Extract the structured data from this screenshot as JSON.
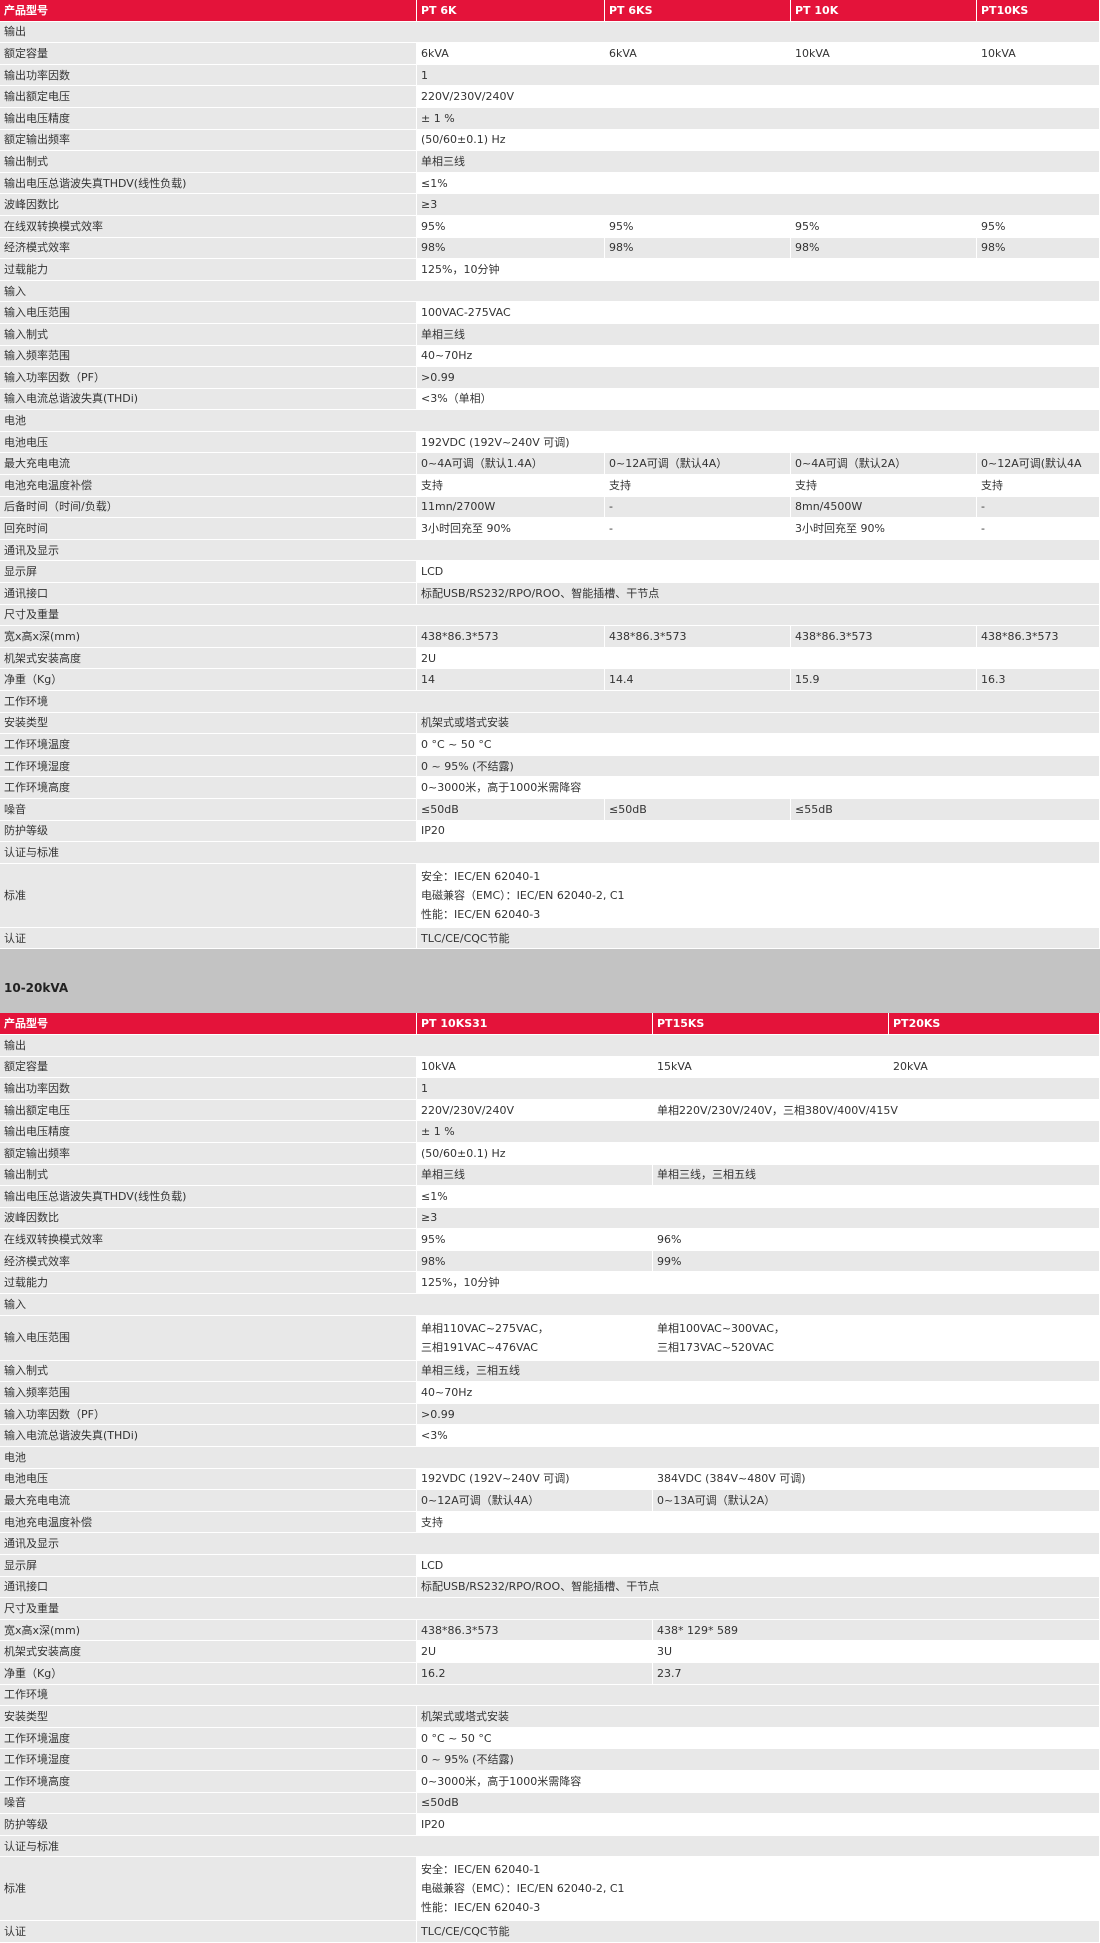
{
  "colors": {
    "header_red": "#e4133a",
    "band_gray": "#c3c3c3",
    "row_gray": "#e8e8e8"
  },
  "tables": [
    {
      "widths": [
        417,
        188,
        186,
        186,
        123
      ],
      "header": [
        "产品型号",
        "PT 6K",
        "PT 6KS",
        "PT 10K",
        "PT10KS"
      ],
      "rows": [
        {
          "cells": [
            [
              "输出"
            ]
          ]
        },
        {
          "cells": [
            [
              "额定容量"
            ],
            [
              "6kVA"
            ],
            [
              "6kVA"
            ],
            [
              "10kVA"
            ],
            [
              "10kVA"
            ]
          ]
        },
        {
          "cells": [
            [
              "输出功率因数"
            ],
            [
              "1"
            ]
          ]
        },
        {
          "cells": [
            [
              "输出额定电压"
            ],
            [
              "220V/230V/240V"
            ]
          ]
        },
        {
          "cells": [
            [
              "输出电压精度"
            ],
            [
              "± 1 %"
            ]
          ]
        },
        {
          "cells": [
            [
              "额定输出频率"
            ],
            [
              "(50/60±0.1) Hz"
            ]
          ]
        },
        {
          "cells": [
            [
              "输出制式"
            ],
            [
              "单相三线"
            ]
          ]
        },
        {
          "cells": [
            [
              "输出电压总谐波失真THDV(线性负载)"
            ],
            [
              "≤1%"
            ]
          ]
        },
        {
          "cells": [
            [
              "波峰因数比"
            ],
            [
              "≥3"
            ]
          ]
        },
        {
          "cells": [
            [
              "在线双转换模式效率"
            ],
            [
              "95%"
            ],
            [
              "95%"
            ],
            [
              "95%"
            ],
            [
              "95%"
            ]
          ]
        },
        {
          "cells": [
            [
              "经济模式效率"
            ],
            [
              "98%"
            ],
            [
              "98%"
            ],
            [
              "98%"
            ],
            [
              "98%"
            ]
          ]
        },
        {
          "cells": [
            [
              "过载能力"
            ],
            [
              "125%，10分钟"
            ]
          ]
        },
        {
          "cells": [
            [
              "输入"
            ]
          ]
        },
        {
          "cells": [
            [
              "输入电压范围"
            ],
            [
              "100VAC-275VAC"
            ]
          ]
        },
        {
          "cells": [
            [
              "输入制式"
            ],
            [
              "单相三线"
            ]
          ]
        },
        {
          "cells": [
            [
              "输入频率范围"
            ],
            [
              "40~70Hz"
            ]
          ]
        },
        {
          "cells": [
            [
              "输入功率因数（PF）"
            ],
            [
              ">0.99"
            ]
          ]
        },
        {
          "cells": [
            [
              "输入电流总谐波失真(THDi)"
            ],
            [
              "<3%（单相）"
            ]
          ]
        },
        {
          "cells": [
            [
              "电池"
            ]
          ]
        },
        {
          "cells": [
            [
              "电池电压"
            ],
            [
              "192VDC (192V~240V 可调)"
            ]
          ]
        },
        {
          "cells": [
            [
              "最大充电电流"
            ],
            [
              "0~4A可调（默认1.4A）"
            ],
            [
              "0~12A可调（默认4A）"
            ],
            [
              "0~4A可调（默认2A）"
            ],
            [
              "0~12A可调(默认4A"
            ]
          ]
        },
        {
          "cells": [
            [
              "电池充电温度补偿"
            ],
            [
              "支持"
            ],
            [
              "支持"
            ],
            [
              "支持"
            ],
            [
              "支持"
            ]
          ]
        },
        {
          "cells": [
            [
              "后备时间（时间/负载）"
            ],
            [
              "11mn/2700W"
            ],
            [
              "-"
            ],
            [
              "8mn/4500W"
            ],
            [
              "-"
            ]
          ]
        },
        {
          "cells": [
            [
              "回充时间"
            ],
            [
              "3小时回充至 90%"
            ],
            [
              "-"
            ],
            [
              "3小时回充至 90%"
            ],
            [
              "-"
            ]
          ]
        },
        {
          "cells": [
            [
              "通讯及显示"
            ]
          ]
        },
        {
          "cells": [
            [
              "显示屏"
            ],
            [
              "LCD"
            ]
          ]
        },
        {
          "cells": [
            [
              "通讯接口"
            ],
            [
              "标配USB/RS232/RPO/ROO、智能插槽、干节点"
            ]
          ]
        },
        {
          "cells": [
            [
              "尺寸及重量"
            ]
          ]
        },
        {
          "cells": [
            [
              "宽x高x深(mm)"
            ],
            [
              "438*86.3*573"
            ],
            [
              "438*86.3*573"
            ],
            [
              "438*86.3*573"
            ],
            [
              "438*86.3*573"
            ]
          ]
        },
        {
          "cells": [
            [
              "机架式安装高度"
            ],
            [
              "2U"
            ]
          ]
        },
        {
          "cells": [
            [
              "净重（Kg）"
            ],
            [
              "14"
            ],
            [
              "14.4"
            ],
            [
              "15.9"
            ],
            [
              "16.3"
            ]
          ]
        },
        {
          "cells": [
            [
              "工作环境"
            ]
          ]
        },
        {
          "cells": [
            [
              "安装类型"
            ],
            [
              "机架式或塔式安装"
            ]
          ]
        },
        {
          "cells": [
            [
              "工作环境温度"
            ],
            [
              "0 °C ~ 50 °C"
            ]
          ]
        },
        {
          "cells": [
            [
              "工作环境湿度"
            ],
            [
              "0 ~ 95% (不结露)"
            ]
          ]
        },
        {
          "cells": [
            [
              "工作环境高度"
            ],
            [
              "0~3000米，高于1000米需降容"
            ]
          ]
        },
        {
          "cells": [
            [
              "噪音"
            ],
            [
              "≤50dB"
            ],
            [
              "≤50dB"
            ],
            [
              "≤55dB"
            ]
          ]
        },
        {
          "cells": [
            [
              "防护等级"
            ],
            [
              "IP20"
            ]
          ]
        },
        {
          "cells": [
            [
              "认证与标准"
            ]
          ]
        },
        {
          "cells": [
            [
              "标准"
            ],
            [
              "安全：IEC/EN 62040-1",
              "电磁兼容（EMC）：IEC/EN 62040-2, C1",
              "性能：IEC/EN 62040-3"
            ]
          ]
        },
        {
          "cells": [
            [
              "认证"
            ],
            [
              "TLC/CE/CQC节能"
            ]
          ]
        }
      ]
    },
    {
      "title": "10-20kVA",
      "widths": [
        417,
        236,
        236,
        211
      ],
      "header": [
        "产品型号",
        "PT 10KS31",
        "PT15KS",
        "PT20KS"
      ],
      "rows": [
        {
          "cells": [
            [
              "输出"
            ]
          ]
        },
        {
          "cells": [
            [
              "额定容量"
            ],
            [
              "10kVA"
            ],
            [
              "15kVA"
            ],
            [
              "20kVA"
            ]
          ]
        },
        {
          "cells": [
            [
              "输出功率因数"
            ],
            [
              "1"
            ]
          ]
        },
        {
          "cells": [
            [
              "输出额定电压"
            ],
            [
              "220V/230V/240V"
            ],
            [
              "单相220V/230V/240V，三相380V/400V/415V"
            ]
          ]
        },
        {
          "cells": [
            [
              "输出电压精度"
            ],
            [
              "± 1 %"
            ]
          ]
        },
        {
          "cells": [
            [
              "额定输出频率"
            ],
            [
              "(50/60±0.1) Hz"
            ]
          ]
        },
        {
          "cells": [
            [
              "输出制式"
            ],
            [
              "单相三线"
            ],
            [
              "单相三线，三相五线"
            ]
          ]
        },
        {
          "cells": [
            [
              "输出电压总谐波失真THDV(线性负载)"
            ],
            [
              "≤1%"
            ]
          ]
        },
        {
          "cells": [
            [
              "波峰因数比"
            ],
            [
              "≥3"
            ]
          ]
        },
        {
          "cells": [
            [
              "在线双转换模式效率"
            ],
            [
              "95%"
            ],
            [
              "96%"
            ]
          ]
        },
        {
          "cells": [
            [
              "经济模式效率"
            ],
            [
              "98%"
            ],
            [
              "99%"
            ]
          ]
        },
        {
          "cells": [
            [
              "过载能力"
            ],
            [
              "125%，10分钟"
            ]
          ]
        },
        {
          "cells": [
            [
              "输入"
            ]
          ]
        },
        {
          "cells": [
            [
              "输入电压范围"
            ],
            [
              "单相110VAC~275VAC，",
              "三相191VAC~476VAC"
            ],
            [
              "单相100VAC~300VAC，",
              "三相173VAC~520VAC"
            ]
          ]
        },
        {
          "cells": [
            [
              "输入制式"
            ],
            [
              "单相三线，三相五线"
            ]
          ]
        },
        {
          "cells": [
            [
              "输入频率范围"
            ],
            [
              "40~70Hz"
            ]
          ]
        },
        {
          "cells": [
            [
              "输入功率因数（PF）"
            ],
            [
              ">0.99"
            ]
          ]
        },
        {
          "cells": [
            [
              "输入电流总谐波失真(THDi)"
            ],
            [
              "<3%"
            ]
          ]
        },
        {
          "cells": [
            [
              "电池"
            ]
          ]
        },
        {
          "cells": [
            [
              "电池电压"
            ],
            [
              "192VDC (192V~240V 可调)"
            ],
            [
              "384VDC (384V~480V 可调)"
            ]
          ]
        },
        {
          "cells": [
            [
              "最大充电电流"
            ],
            [
              "0~12A可调（默认4A）"
            ],
            [
              "0~13A可调（默认2A）"
            ]
          ]
        },
        {
          "cells": [
            [
              "电池充电温度补偿"
            ],
            [
              "支持"
            ]
          ]
        },
        {
          "cells": [
            [
              "通讯及显示"
            ]
          ]
        },
        {
          "cells": [
            [
              "显示屏"
            ],
            [
              "LCD"
            ]
          ]
        },
        {
          "cells": [
            [
              "通讯接口"
            ],
            [
              "标配USB/RS232/RPO/ROO、智能插槽、干节点"
            ]
          ]
        },
        {
          "cells": [
            [
              "尺寸及重量"
            ]
          ]
        },
        {
          "cells": [
            [
              "宽x高x深(mm)"
            ],
            [
              "438*86.3*573"
            ],
            [
              "438* 129* 589"
            ]
          ]
        },
        {
          "cells": [
            [
              "机架式安装高度"
            ],
            [
              "2U"
            ],
            [
              "3U"
            ]
          ]
        },
        {
          "cells": [
            [
              "净重（Kg）"
            ],
            [
              "16.2"
            ],
            [
              "23.7"
            ]
          ]
        },
        {
          "cells": [
            [
              "工作环境"
            ]
          ]
        },
        {
          "cells": [
            [
              "安装类型"
            ],
            [
              "机架式或塔式安装"
            ]
          ]
        },
        {
          "cells": [
            [
              "工作环境温度"
            ],
            [
              "0 °C ~ 50 °C"
            ]
          ]
        },
        {
          "cells": [
            [
              "工作环境湿度"
            ],
            [
              "0 ~ 95% (不结露)"
            ]
          ]
        },
        {
          "cells": [
            [
              "工作环境高度"
            ],
            [
              "0~3000米，高于1000米需降容"
            ]
          ]
        },
        {
          "cells": [
            [
              "噪音"
            ],
            [
              "≤50dB"
            ]
          ]
        },
        {
          "cells": [
            [
              "防护等级"
            ],
            [
              "IP20"
            ]
          ]
        },
        {
          "cells": [
            [
              "认证与标准"
            ]
          ]
        },
        {
          "cells": [
            [
              "标准"
            ],
            [
              "安全：IEC/EN 62040-1",
              "电磁兼容（EMC）：IEC/EN 62040-2, C1",
              "性能：IEC/EN 62040-3"
            ]
          ]
        },
        {
          "cells": [
            [
              "认证"
            ],
            [
              "TLC/CE/CQC节能"
            ]
          ]
        }
      ]
    }
  ]
}
